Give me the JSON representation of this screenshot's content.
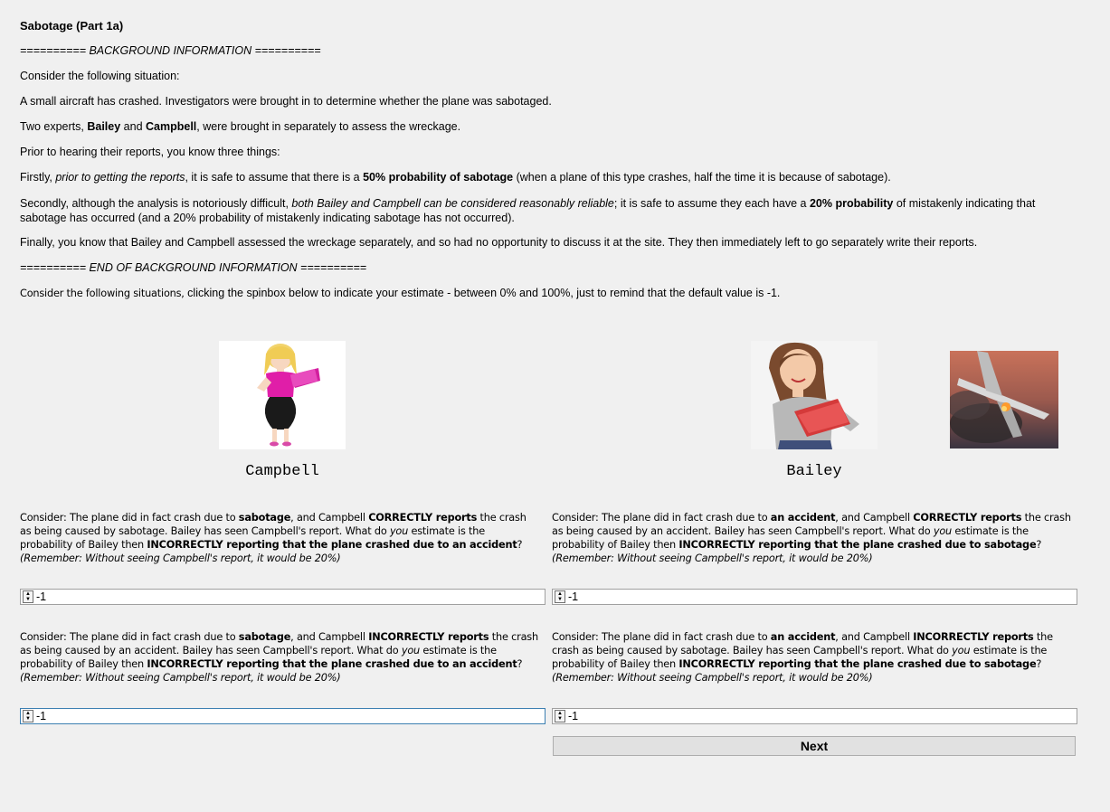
{
  "title": "Sabotage (Part 1a)",
  "bg_start": "========== BACKGROUND INFORMATION ==========",
  "consider": "Consider the following situation:",
  "p1": "A small aircraft has crashed. Investigators were brought in to determine whether the plane was sabotaged.",
  "p2": {
    "a": "Two experts, ",
    "b": "Bailey",
    "c": " and ",
    "d": "Campbell",
    "e": ", were brought in separately to assess the wreckage."
  },
  "p3": "Prior to hearing their reports, you know three things:",
  "p4": {
    "a": "Firstly, ",
    "b": "prior to getting the reports",
    "c": ", it is safe to assume that there is a ",
    "d": "50% probability of sabotage",
    "e": " (when a plane of this type crashes, half the time it is because of sabotage)."
  },
  "p5": {
    "a": "Secondly, although the analysis is notoriously difficult, ",
    "b": "both Bailey and Campbell can be considered reasonably reliable",
    "c": "; it is safe to assume they each have a ",
    "d": "20% probability",
    "e": " of mistakenly indicating that sabotage has occurred (and a 20% probability of mistakenly indicating sabotage has not occurred)."
  },
  "p6": "Finally, you know that Bailey and Campbell assessed the wreckage separately, and so had no opportunity to discuss it at the site. They then immediately left to go separately write their reports.",
  "bg_end": "========== END OF BACKGROUND INFORMATION ==========",
  "instruction": {
    "a": "Consider the following situations,",
    "b": " clicking the spinbox below to indicate your estimate - between 0% and 100%, just to remind that the default value is -1."
  },
  "names": {
    "left": "Campbell",
    "right": "Bailey"
  },
  "questions": {
    "q1": {
      "a": "Consider: The plane did in fact crash due to ",
      "b": "sabotage",
      "c": ", and Campbell ",
      "d": "CORRECTLY reports",
      "e": " the crash as being caused by sabotage. Bailey has seen Campbell's report. What do ",
      "f": "you",
      "g": " estimate is the probability of Bailey then ",
      "h": "INCORRECTLY reporting that the plane crashed due to an accident",
      "i": "?",
      "remember": "(Remember: Without seeing Campbell's report, it would be 20%)"
    },
    "q2": {
      "a": "Consider: The plane did in fact crash due to ",
      "b": "an accident",
      "c": ", and Campbell ",
      "d": "CORRECTLY reports",
      "e": " the crash as being caused by an accident. Bailey has seen Campbell's report. What do ",
      "f": "you",
      "g": " estimate is the probability of Bailey then ",
      "h": "INCORRECTLY reporting that the plane crashed due to sabotage",
      "i": "?",
      "remember": "(Remember: Without seeing Campbell's report, it would be 20%)"
    },
    "q3": {
      "a": "Consider: The plane did in fact crash due to ",
      "b": "sabotage",
      "c": ", and Campbell ",
      "d": "INCORRECTLY reports",
      "e": " the crash as being caused by an accident. Bailey has seen Campbell's report. What do ",
      "f": "you",
      "g": " estimate is the probability of Bailey then ",
      "h": "INCORRECTLY reporting that the plane crashed due to an accident",
      "i": "?",
      "remember": "(Remember: Without seeing Campbell's report, it would be 20%)"
    },
    "q4": {
      "a": "Consider: The plane did in fact crash due to ",
      "b": "an accident",
      "c": ", and Campbell ",
      "d": "INCORRECTLY reports",
      "e": " the crash as being caused by sabotage. Bailey has seen Campbell's report. What do ",
      "f": "you",
      "g": " estimate is the probability of Bailey then ",
      "h": "INCORRECTLY reporting that the plane crashed due to sabotage",
      "i": "?",
      "remember": "(Remember: Without seeing Campbell's report, it would be 20%)"
    }
  },
  "spinboxes": {
    "s1": "-1",
    "s2": "-1",
    "s3": "-1",
    "s4": "-1"
  },
  "next_label": "Next"
}
